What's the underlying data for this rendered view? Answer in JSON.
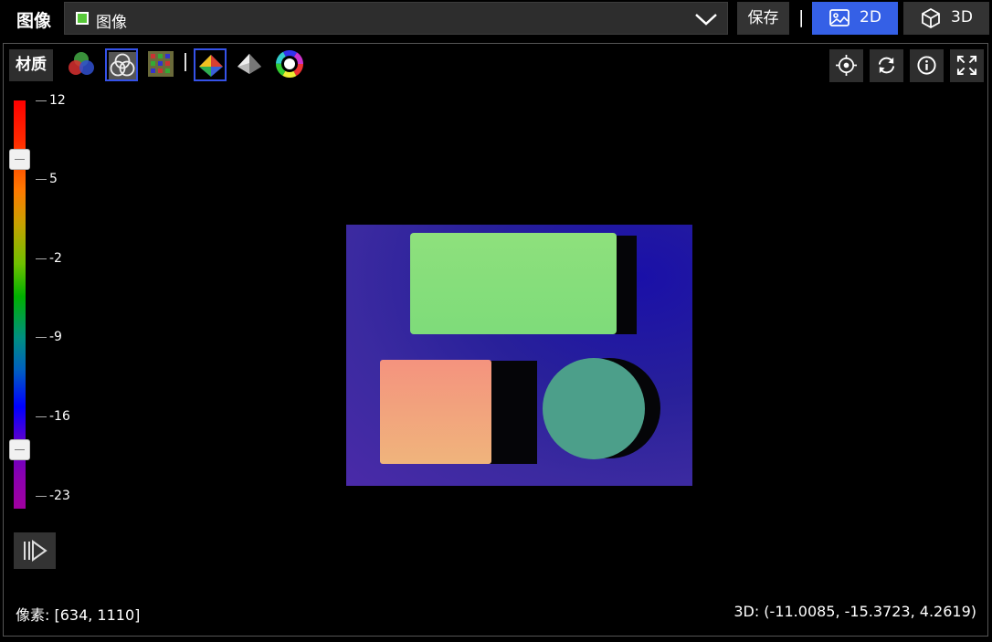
{
  "header": {
    "title": "图像",
    "selector": {
      "swatch_color": "#58c93a",
      "label": "图像"
    },
    "save_label": "保存",
    "separator": "|",
    "mode_2d_label": "2D",
    "mode_3d_label": "3D",
    "active_mode": "2D"
  },
  "toolbar": {
    "material_label": "材质",
    "tools": [
      {
        "name": "rgb-channels-icon",
        "selected": false
      },
      {
        "name": "channel-overlap-icon",
        "selected": true
      },
      {
        "name": "color-grid-icon",
        "selected": false
      },
      {
        "name": "height-map-icon",
        "selected": true
      },
      {
        "name": "shaded-surface-icon",
        "selected": false
      },
      {
        "name": "color-wheel-icon",
        "selected": false
      }
    ],
    "right_buttons": [
      "locate-icon",
      "refresh-icon",
      "info-icon",
      "fullscreen-icon"
    ]
  },
  "colorbar": {
    "ticks": [
      "12",
      "5",
      "-2",
      "-9",
      "-16",
      "-23"
    ],
    "upper_handle_value": 6.2,
    "lower_handle_value": -17.5
  },
  "status": {
    "pixel_label": "像素: [634, 1110]",
    "coord_label": "3D: (-11.0085, -15.3723, 4.2619)"
  },
  "colors": {
    "accent": "#3560e6",
    "panel": "#2e2e2e"
  }
}
